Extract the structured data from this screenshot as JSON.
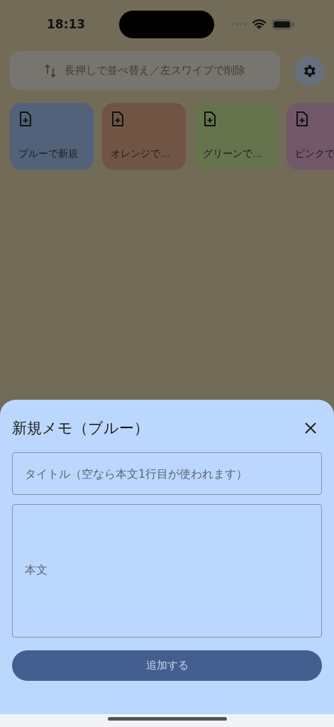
{
  "status_bar": {
    "time": "18:13"
  },
  "hint_bar": {
    "text": "長押しで並べ替え／左スワイプで削除"
  },
  "templates": [
    {
      "label": "ブルーで新規",
      "color": "#52627a"
    },
    {
      "label": "オレンジで…",
      "color": "#705545"
    },
    {
      "label": "グリーンで…",
      "color": "#65744d"
    },
    {
      "label": "ピンクで",
      "color": "#725869"
    }
  ],
  "sheet": {
    "title": "新規メモ（ブルー）",
    "title_field": {
      "placeholder": "タイトル（空なら本文1行目が使われます）"
    },
    "body_field": {
      "placeholder": "本文"
    },
    "submit": "追加する"
  }
}
